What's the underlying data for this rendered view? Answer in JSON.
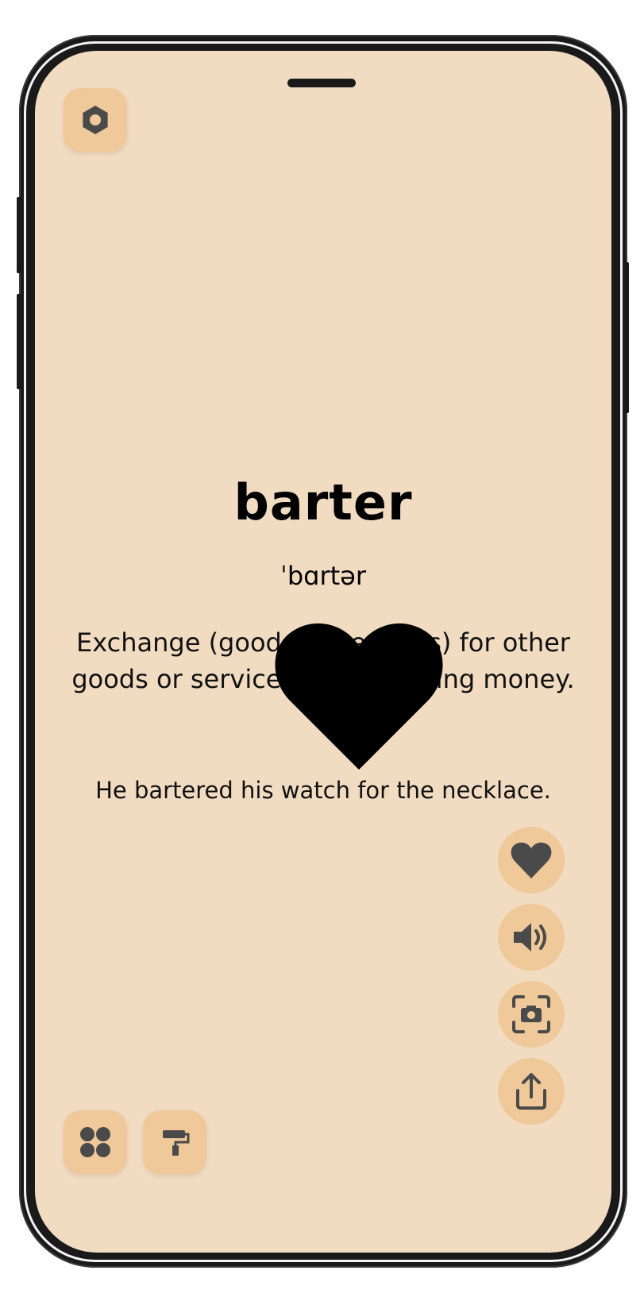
{
  "entry": {
    "word": "barter",
    "phonetic": "ˈbɑrtər",
    "definition": "Exchange (goods or services) for other goods or services without using money.",
    "example": "He bartered his watch for the necklace."
  },
  "top_left_button": {
    "icon": "hexagon-nut-icon"
  },
  "side_actions": [
    {
      "icon": "heart-icon"
    },
    {
      "icon": "speaker-icon"
    },
    {
      "icon": "screenshot-camera-icon"
    },
    {
      "icon": "share-icon"
    }
  ],
  "bottom_buttons": [
    {
      "icon": "grid-icon"
    },
    {
      "icon": "paint-roller-icon"
    }
  ],
  "overlay": {
    "icon": "heart-icon",
    "color": "#000000"
  },
  "theme": {
    "screen_bg": "#f1dcc2",
    "button_bg": "#f0c99a",
    "icon_color": "#4a4a4a"
  }
}
